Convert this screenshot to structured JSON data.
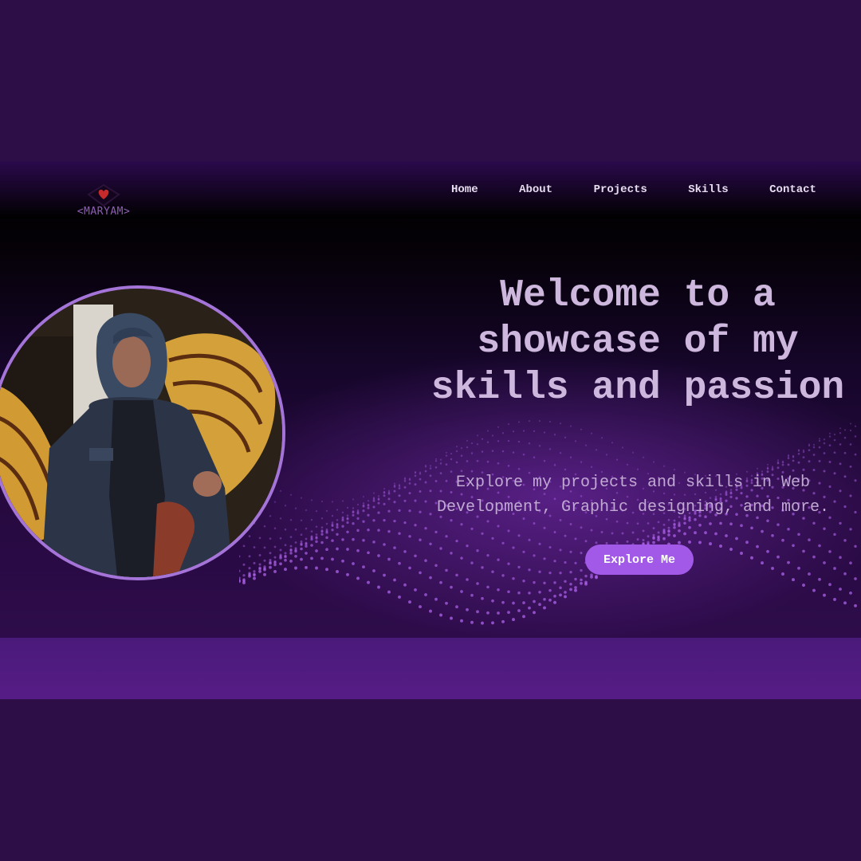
{
  "logo": {
    "text": "<MARYAM>",
    "icon": "heart-diamond-icon",
    "colors": {
      "heart": "#c62b2b",
      "text": "#8d5fb4"
    }
  },
  "nav": {
    "items": [
      {
        "label": "Home"
      },
      {
        "label": "About"
      },
      {
        "label": "Projects"
      },
      {
        "label": "Skills"
      },
      {
        "label": "Contact"
      }
    ]
  },
  "hero": {
    "headline": "Welcome to a showcase of my skills and passion",
    "subtitle_line1": "Explore my projects and skills in Web",
    "subtitle_line2": "Development, Graphic designing, and more.",
    "cta_label": "Explore Me"
  },
  "profile_photo": {
    "alt": "profile photo",
    "border_color": "#a474d9"
  },
  "theme": {
    "page_bg": "#2d0e47",
    "accent": "#a259e8",
    "heading_color": "#cdb7dd",
    "footer_band": "#561c86"
  }
}
